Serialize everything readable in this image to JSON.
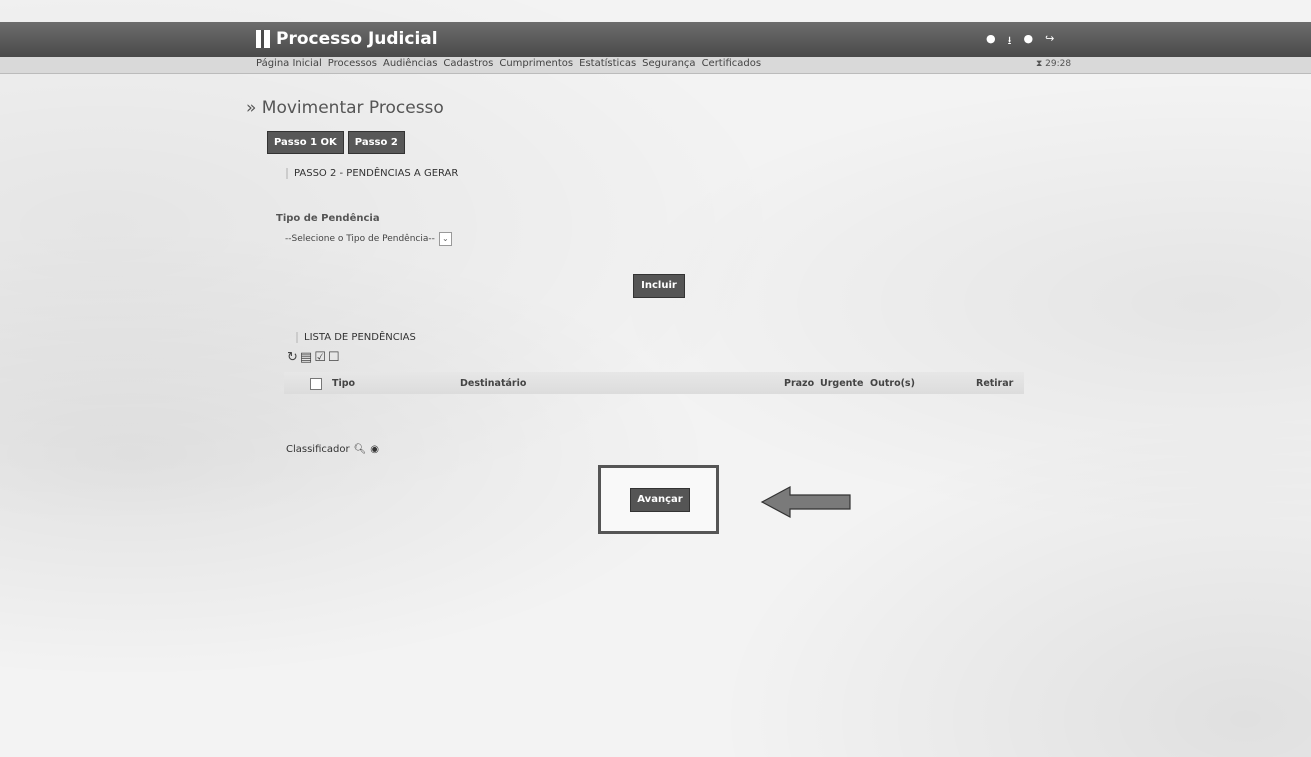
{
  "header": {
    "app_title": "Processo Judicial",
    "icons": [
      "help-icon",
      "download-icon",
      "chat-icon",
      "logout-icon"
    ],
    "timer": "⧗ 29:28"
  },
  "nav": {
    "items": [
      "Página Inicial",
      "Processos",
      "Audiências",
      "Cadastros",
      "Cumprimentos",
      "Estatísticas",
      "Segurança",
      "Certificados"
    ]
  },
  "page": {
    "title": "» Movimentar Processo",
    "steps": [
      "Passo 1 OK",
      "Passo 2"
    ],
    "section_title": "PASSO 2 - PENDÊNCIAS A GERAR",
    "tipo_label": "Tipo de Pendência",
    "tipo_select_value": "--Selecione o Tipo de Pendência--",
    "incluir_label": "Incluir",
    "lista_title": "LISTA DE PENDÊNCIAS",
    "table_headers": {
      "tipo": "Tipo",
      "destinatario": "Destinatário",
      "prazo": "Prazo",
      "urgente": "Urgente",
      "outros": "Outro(s)",
      "retirar": "Retirar"
    },
    "classificador_label": "Classificador",
    "avancar_label": "Avançar"
  },
  "colors": {
    "header_bg": "#555555",
    "button_bg": "#555555",
    "nav_bg": "#d9d9d9"
  }
}
